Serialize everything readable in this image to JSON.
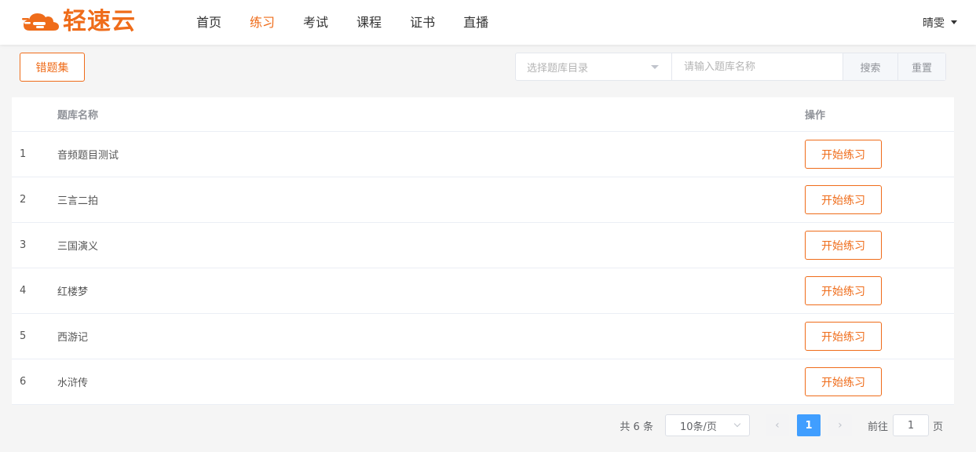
{
  "header": {
    "logo_text": "轻速云",
    "nav": [
      "首页",
      "练习",
      "考试",
      "课程",
      "证书",
      "直播"
    ],
    "active_nav": "练习",
    "user_name": "晴雯"
  },
  "toolbar": {
    "wrong_set_label": "错题集",
    "select_placeholder": "选择题库目录",
    "search_placeholder": "请输入题库名称",
    "search_label": "搜索",
    "reset_label": "重置"
  },
  "table": {
    "columns": [
      "",
      "题库名称",
      "操作"
    ],
    "rows": [
      {
        "index": "1",
        "name": "音频题目测试",
        "action": "开始练习"
      },
      {
        "index": "2",
        "name": "三言二拍",
        "action": "开始练习"
      },
      {
        "index": "3",
        "name": "三国演义",
        "action": "开始练习"
      },
      {
        "index": "4",
        "name": "红楼梦",
        "action": "开始练习"
      },
      {
        "index": "5",
        "name": "西游记",
        "action": "开始练习"
      },
      {
        "index": "6",
        "name": "水浒传",
        "action": "开始练习"
      }
    ]
  },
  "pagination": {
    "total_text": "共 6 条",
    "page_size": "10条/页",
    "current_page": "1",
    "prev_icon": "chevron-left-icon",
    "next_icon": "chevron-right-icon",
    "goto_label": "前往",
    "goto_value": "1",
    "page_unit": "页"
  },
  "colors": {
    "accent": "#ef6c1a",
    "page_active": "#409eff"
  }
}
